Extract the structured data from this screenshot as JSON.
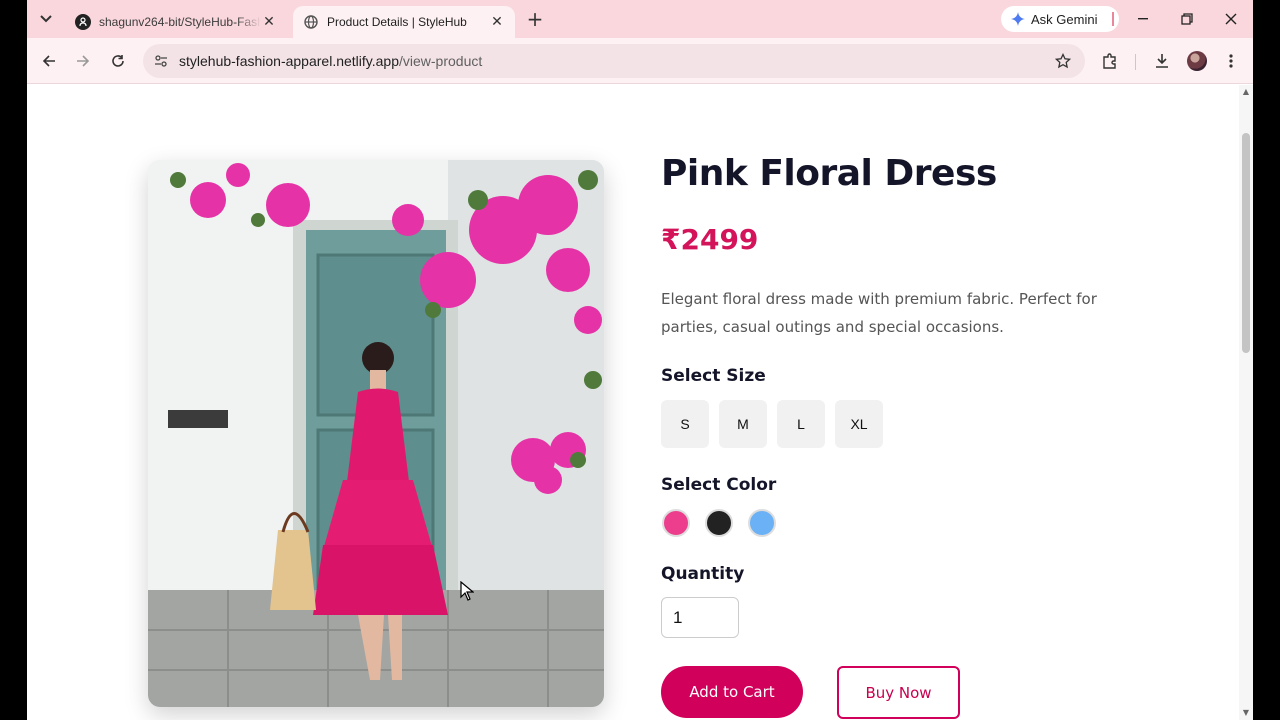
{
  "browser": {
    "tabs": [
      {
        "title": "shagunv264-bit/StyleHub-Fashion-Apparel",
        "favicon": "github-icon",
        "active": false
      },
      {
        "title": "Product Details | StyleHub",
        "favicon": "globe-icon",
        "active": true
      }
    ],
    "ask_gemini": "Ask Gemini",
    "url_host": "stylehub-fashion-apparel.netlify.app",
    "url_path": "/view-product"
  },
  "product": {
    "name": "Pink Floral Dress",
    "price": "₹2499",
    "description": "Elegant floral dress made with premium fabric. Perfect for parties, casual outings and special occasions.",
    "size_label": "Select Size",
    "sizes": [
      "S",
      "M",
      "L",
      "XL"
    ],
    "color_label": "Select Color",
    "colors": [
      "#ec3e8c",
      "#222222",
      "#6bb1f5"
    ],
    "quantity_label": "Quantity",
    "quantity": "1",
    "add_to_cart": "Add to Cart",
    "buy_now": "Buy Now"
  },
  "theme": {
    "accent": "#d1005a",
    "tabbar": "#f9d7dd"
  }
}
